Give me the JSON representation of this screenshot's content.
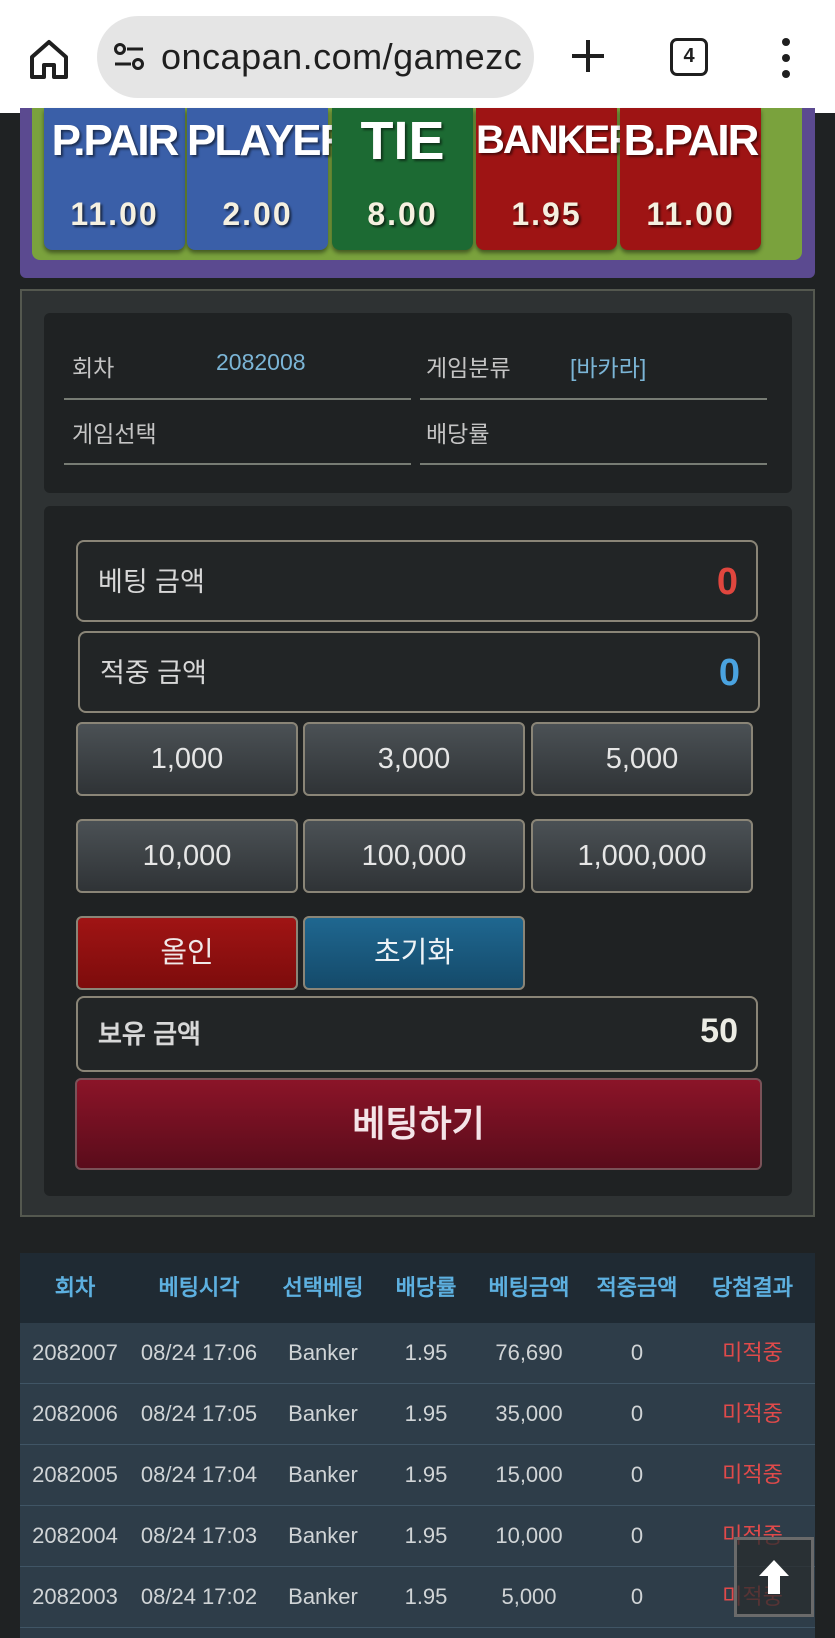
{
  "browser": {
    "url": "oncapan.com/gamezc",
    "tab_count": "4"
  },
  "odds": [
    {
      "name": "P.PAIR",
      "value": "11.00",
      "color": "#3a5fa8"
    },
    {
      "name": "PLAYER",
      "value": "2.00",
      "color": "#3a5fa8"
    },
    {
      "name": "TIE",
      "value": "8.00",
      "color": "#1c6a33"
    },
    {
      "name": "BANKER",
      "value": "1.95",
      "color": "#9e1414"
    },
    {
      "name": "B.PAIR",
      "value": "11.00",
      "color": "#9e1414"
    }
  ],
  "info": {
    "round_label": "회차",
    "round_value": "2082008",
    "category_label": "게임분류",
    "category_value": "[바카라]",
    "game_select_label": "게임선택",
    "game_select_value": "",
    "odds_rate_label": "배당률",
    "odds_rate_value": ""
  },
  "bet_form": {
    "bet_amount_label": "베팅 금액",
    "bet_amount_value": "0",
    "win_amount_label": "적중 금액",
    "win_amount_value": "0",
    "amount_buttons": [
      "1,000",
      "3,000",
      "5,000",
      "10,000",
      "100,000",
      "1,000,000"
    ],
    "allin_label": "올인",
    "reset_label": "초기화",
    "balance_label": "보유 금액",
    "balance_value": "50",
    "submit_label": "베팅하기",
    "bet_value_color": "#e0463e",
    "win_value_color": "#4aa3e0"
  },
  "history": {
    "headers": [
      "회차",
      "베팅시각",
      "선택베팅",
      "배당률",
      "베팅금액",
      "적중금액",
      "당첨결과"
    ],
    "rows": [
      [
        "2082007",
        "08/24 17:06",
        "Banker",
        "1.95",
        "76,690",
        "0",
        "미적중"
      ],
      [
        "2082006",
        "08/24 17:05",
        "Banker",
        "1.95",
        "35,000",
        "0",
        "미적중"
      ],
      [
        "2082005",
        "08/24 17:04",
        "Banker",
        "1.95",
        "15,000",
        "0",
        "미적중"
      ],
      [
        "2082004",
        "08/24 17:03",
        "Banker",
        "1.95",
        "10,000",
        "0",
        "미적중"
      ],
      [
        "2082003",
        "08/24 17:02",
        "Banker",
        "1.95",
        "5,000",
        "0",
        "미적중"
      ]
    ]
  }
}
